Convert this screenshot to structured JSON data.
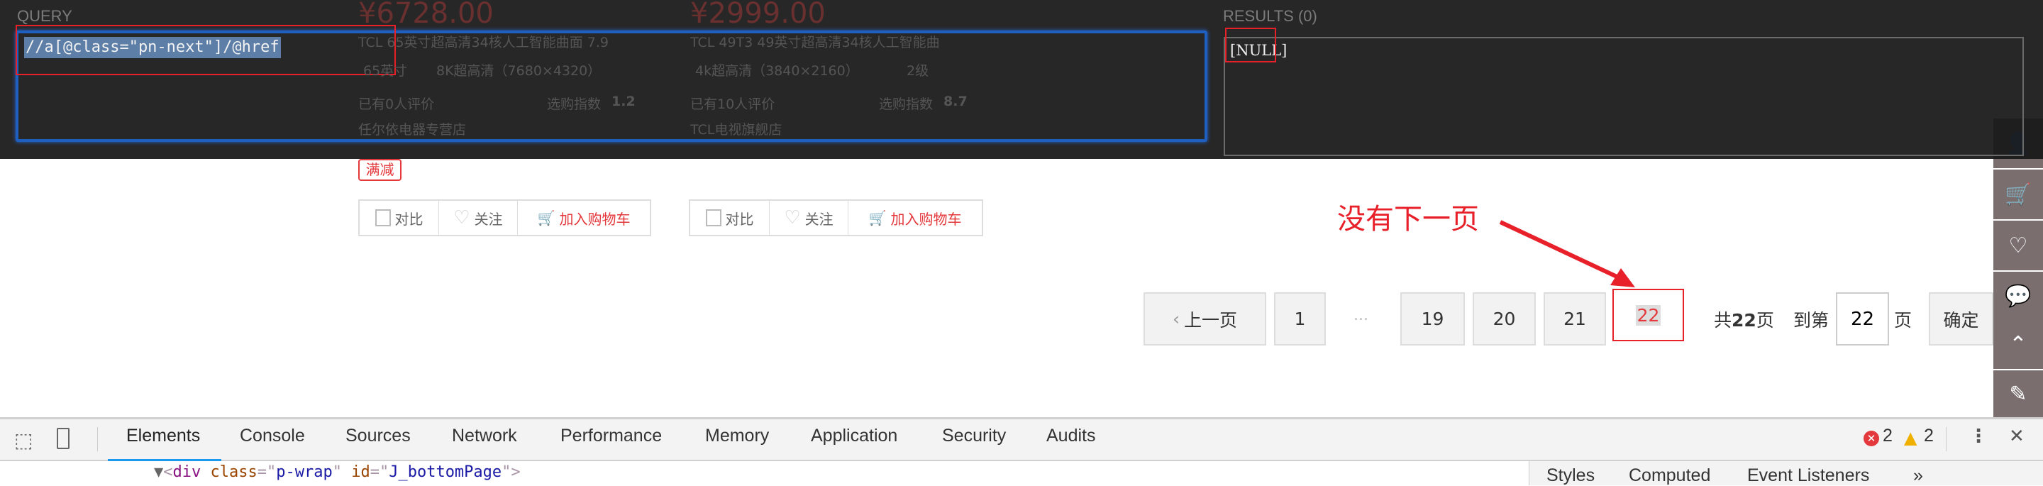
{
  "page": {
    "products": [
      {
        "price": "¥6728.00",
        "title": "TCL 65英寸超高清34核人工智能曲面 7.9",
        "tags": [
          "65英寸",
          "8K超高清（7680×4320）"
        ],
        "reviews": "已有0人评价",
        "index_label": "选购指数",
        "index_value": "1.2",
        "store": "任尔依电器专营店",
        "promo": "满减",
        "compare": "对比",
        "follow": "关注",
        "add_cart": "加入购物车"
      },
      {
        "price": "¥2999.00",
        "title": "TCL 49T3 49英寸超高清34核人工智能曲",
        "tags": [
          "4k超高清（3840×2160）",
          "2级"
        ],
        "reviews": "已有10人评价",
        "index_label": "选购指数",
        "index_value": "8.7",
        "store": "TCL电视旗舰店",
        "compare": "对比",
        "follow": "关注",
        "add_cart": "加入购物车"
      }
    ],
    "annotation": "没有下一页",
    "pagination": {
      "prev": "上一页",
      "pages": [
        "1",
        "19",
        "20",
        "21",
        "22"
      ],
      "ellipsis": "...",
      "current": "22",
      "total_prefix": "共",
      "total": "22",
      "total_suffix": "页",
      "goto_label": "到第",
      "goto_value": "22",
      "goto_suffix": "页",
      "confirm": "确定"
    }
  },
  "xpath_helper": {
    "query_label": "QUERY",
    "query": "//a[@class=\"pn-next\"]/@href",
    "results_label": "RESULTS (0)",
    "result": "[NULL]"
  },
  "devtools": {
    "tabs": [
      "Elements",
      "Console",
      "Sources",
      "Network",
      "Performance",
      "Memory",
      "Application",
      "Security",
      "Audits"
    ],
    "active_tab": "Elements",
    "errors": "2",
    "warnings": "2",
    "dom_line": {
      "tag": "div",
      "attr1": "class",
      "val1": "p-wrap",
      "attr2": "id",
      "val2": "J_bottomPage"
    },
    "side_tabs": [
      "Styles",
      "Computed",
      "Event Listeners",
      "»"
    ]
  },
  "colors": {
    "accent": "#e4393c",
    "annotation": "#e8202a",
    "devtools_active": "#1a9bf0"
  }
}
